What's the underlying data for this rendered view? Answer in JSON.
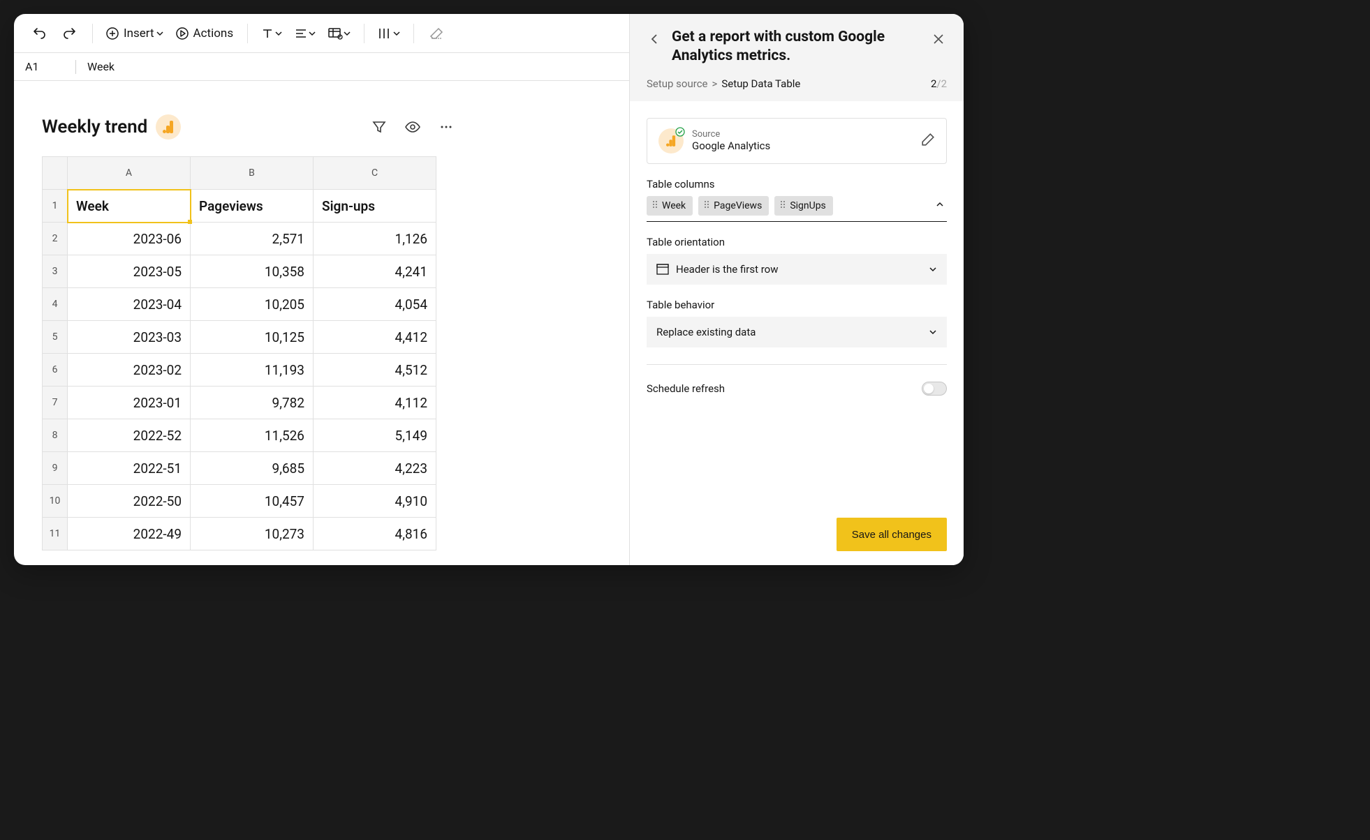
{
  "toolbar": {
    "insert_label": "Insert",
    "actions_label": "Actions"
  },
  "cellbar": {
    "ref": "A1",
    "value": "Week"
  },
  "sheet": {
    "title": "Weekly trend",
    "col_letters": [
      "A",
      "B",
      "C"
    ],
    "headers": [
      "Week",
      "Pageviews",
      "Sign-ups"
    ],
    "rows": [
      {
        "n": 2,
        "cells": [
          "2023-06",
          "2,571",
          "1,126"
        ]
      },
      {
        "n": 3,
        "cells": [
          "2023-05",
          "10,358",
          "4,241"
        ]
      },
      {
        "n": 4,
        "cells": [
          "2023-04",
          "10,205",
          "4,054"
        ]
      },
      {
        "n": 5,
        "cells": [
          "2023-03",
          "10,125",
          "4,412"
        ]
      },
      {
        "n": 6,
        "cells": [
          "2023-02",
          "11,193",
          "4,512"
        ]
      },
      {
        "n": 7,
        "cells": [
          "2023-01",
          "9,782",
          "4,112"
        ]
      },
      {
        "n": 8,
        "cells": [
          "2022-52",
          "11,526",
          "5,149"
        ]
      },
      {
        "n": 9,
        "cells": [
          "2022-51",
          "9,685",
          "4,223"
        ]
      },
      {
        "n": 10,
        "cells": [
          "2022-50",
          "10,457",
          "4,910"
        ]
      },
      {
        "n": 11,
        "cells": [
          "2022-49",
          "10,273",
          "4,816"
        ]
      }
    ]
  },
  "sidebar": {
    "title": "Get a report with custom Google Analytics metrics.",
    "breadcrumb": {
      "prev": "Setup source",
      "active": "Setup Data Table",
      "step": "2",
      "total": "/2"
    },
    "source": {
      "label": "Source",
      "name": "Google Analytics"
    },
    "columns": {
      "label": "Table columns",
      "chips": [
        "Week",
        "PageViews",
        "SignUps"
      ]
    },
    "orientation": {
      "label": "Table orientation",
      "value": "Header is the first row"
    },
    "behavior": {
      "label": "Table behavior",
      "value": "Replace existing data"
    },
    "schedule": {
      "label": "Schedule refresh"
    },
    "save_label": "Save all changes"
  }
}
